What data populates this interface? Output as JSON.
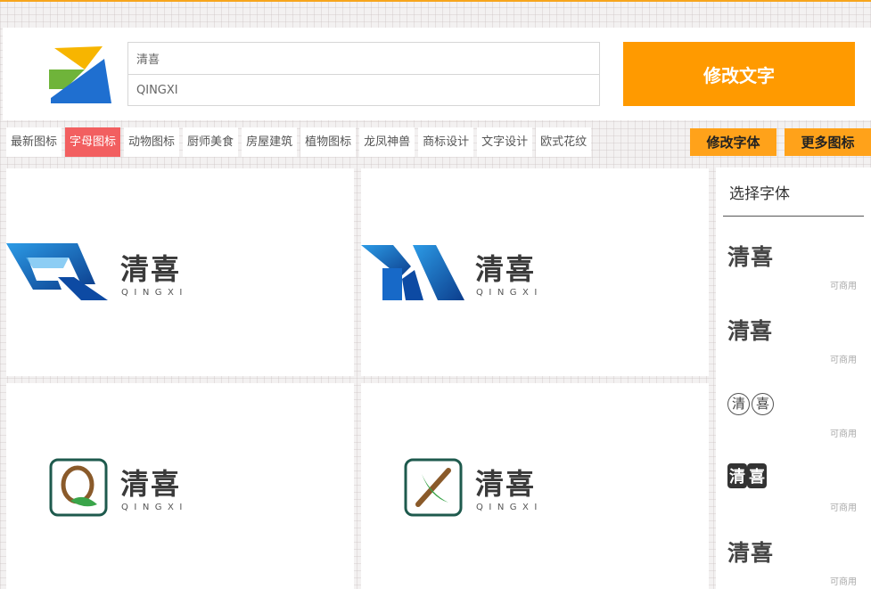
{
  "brand": {
    "name_zh": "清喜",
    "name_en": "QINGXI"
  },
  "inputs": {
    "chinese_value": "清喜",
    "pinyin_value": "QINGXI"
  },
  "buttons": {
    "modify_text": "修改文字",
    "modify_font": "修改字体",
    "more_icons": "更多图标"
  },
  "categories": [
    {
      "label": "最新图标",
      "active": false
    },
    {
      "label": "字母图标",
      "active": true
    },
    {
      "label": "动物图标",
      "active": false
    },
    {
      "label": "厨师美食",
      "active": false
    },
    {
      "label": "房屋建筑",
      "active": false
    },
    {
      "label": "植物图标",
      "active": false
    },
    {
      "label": "龙凤神兽",
      "active": false
    },
    {
      "label": "商标设计",
      "active": false
    },
    {
      "label": "文字设计",
      "active": false
    },
    {
      "label": "欧式花纹",
      "active": false
    }
  ],
  "logo_cards": [
    {
      "icon": "q-letter-blue-icon",
      "text_zh": "清喜",
      "text_en": "QINGXI"
    },
    {
      "icon": "x-letter-blue-icon",
      "text_zh": "清喜",
      "text_en": "QINGXI"
    },
    {
      "icon": "q-leaf-badge-icon",
      "text_zh": "清喜",
      "text_en": "QINGXI"
    },
    {
      "icon": "x-leaf-badge-icon",
      "text_zh": "清喜",
      "text_en": "QINGXI"
    }
  ],
  "font_panel": {
    "title": "选择字体",
    "fonts": [
      {
        "c1": "清",
        "c2": "喜",
        "note": "可商用"
      },
      {
        "c1": "清",
        "c2": "喜",
        "note": "可商用"
      },
      {
        "c1": "清",
        "c2": "喜",
        "note": "可商用"
      },
      {
        "c1": "清",
        "c2": "喜",
        "note": "可商用"
      },
      {
        "c1": "清",
        "c2": "喜",
        "note": "可商用"
      }
    ]
  },
  "colors": {
    "accent_orange": "#ff9a00",
    "active_tab": "#f25f60",
    "logo_blue": "#1a5fb4",
    "badge_green": "#1e5a4d"
  }
}
